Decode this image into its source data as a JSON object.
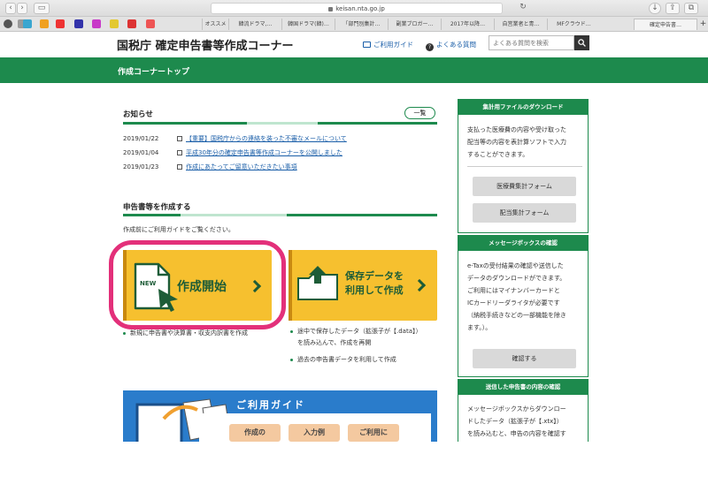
{
  "browser": {
    "url": "keisan.nta.go.jp",
    "tabs": [
      "オススメ",
      "韓流ドラマ,…",
      "韓国ドラマ(韓)…",
      "「部門別集計…",
      "副業ブロガー…",
      "2017年以降…",
      "自営業者と青…",
      "MFクラウド…",
      "確定申告書…"
    ]
  },
  "header": {
    "title": "国税庁 確定申告書等作成コーナー",
    "guide_link": "ご利用ガイド",
    "faq_link": "よくある質問",
    "search_placeholder": "よくある質問を検索"
  },
  "nav": {
    "title": "作成コーナートップ"
  },
  "notices": {
    "heading": "お知らせ",
    "list_button": "一覧",
    "items": [
      {
        "date": "2019/01/22",
        "text": "【重要】国税庁からの連絡を装った不審なメールについて"
      },
      {
        "date": "2019/01/04",
        "text": "平成30年分の確定申告書等作成コーナーを公開しました"
      },
      {
        "date": "2019/01/23",
        "text": "作成にあたってご留意いただきたい事項"
      }
    ]
  },
  "create": {
    "heading": "申告書等を作成する",
    "guide_text": "作成前にご利用ガイドをご覧ください。",
    "new_button": {
      "badge": "NEW",
      "label": "作成開始"
    },
    "load_button": {
      "line1": "保存データを",
      "line2": "利用して作成"
    },
    "new_notes": [
      "新規に申告書や決算書・収支内訳書を作成"
    ],
    "load_notes": [
      "途中で保存したデータ（拡張子が【.data】）",
      "を読み込んで、作成を再開",
      "過去の申告書データを利用して作成"
    ]
  },
  "banner": {
    "title": "ご利用ガイド",
    "cards": [
      "作成の",
      "入力例",
      "ご利用に"
    ]
  },
  "sidebar": {
    "download": {
      "heading": "集計用ファイルのダウンロード",
      "text": [
        "支払った医療費の内容や受け取った",
        "配当等の内容を表計算ソフトで入力",
        "することができます。"
      ],
      "buttons": [
        "医療費集計フォーム",
        "配当集計フォーム"
      ]
    },
    "messagebox": {
      "heading": "メッセージボックスの確認",
      "text": [
        "e-Taxの受付結果の確認や送信した",
        "データのダウンロードができます。",
        "ご利用にはマイナンバーカードと",
        "ICカードリーダライタが必要です",
        "（納税手続きなどの一部機能を除き",
        "ます。）。"
      ],
      "button": "確認する"
    },
    "sent": {
      "heading": "送信した申告書の内容の確認",
      "text": [
        "メッセージボックスからダウンロー",
        "ドしたデータ（拡張子が【.xtx】）",
        "を読み込むと、申告の内容を確認す"
      ]
    }
  },
  "colors": {
    "brand_green": "#1d8a4d",
    "button_yellow": "#f6c02f",
    "highlight_ring": "#e3307a",
    "link_blue": "#1a5ea8"
  }
}
